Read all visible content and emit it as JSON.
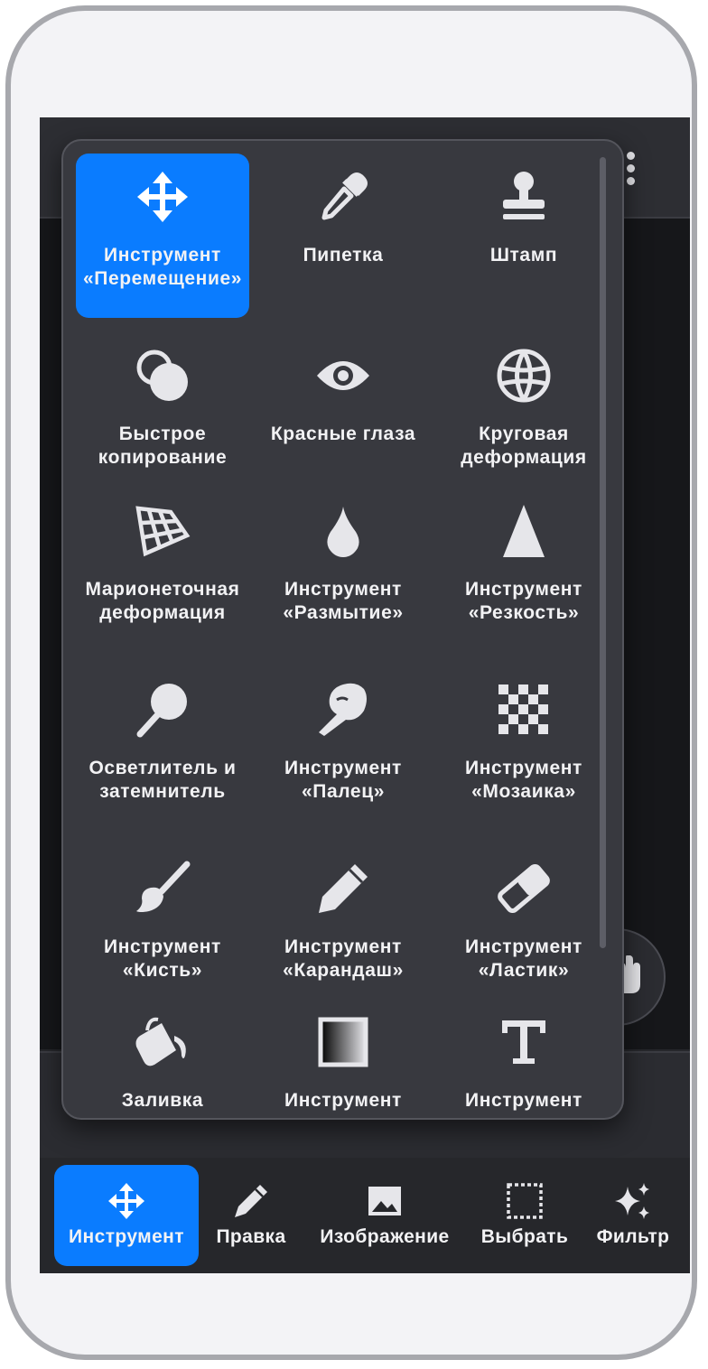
{
  "tools": [
    {
      "label": "Инструмент «Перемещение»",
      "icon": "move-arrows-icon",
      "selected": true
    },
    {
      "label": "Пипетка",
      "icon": "eyedropper-icon"
    },
    {
      "label": "Штамп",
      "icon": "stamp-icon"
    },
    {
      "label": "Быстрое копирование",
      "icon": "quick-copy-circles-icon"
    },
    {
      "label": "Красные глаза",
      "icon": "eye-icon"
    },
    {
      "label": "Круговая деформация",
      "icon": "globe-icon"
    },
    {
      "label": "Марионеточная деформация",
      "icon": "warp-grid-icon"
    },
    {
      "label": "Инструмент «Размытие»",
      "icon": "drop-icon"
    },
    {
      "label": "Инструмент «Резкость»",
      "icon": "triangle-icon"
    },
    {
      "label": "Осветлитель и затемнитель",
      "icon": "dodge-burn-icon"
    },
    {
      "label": "Инструмент «Палец»",
      "icon": "smudge-finger-icon"
    },
    {
      "label": "Инструмент «Мозаика»",
      "icon": "mosaic-checker-icon"
    },
    {
      "label": "Инструмент «Кисть»",
      "icon": "brush-icon"
    },
    {
      "label": "Инструмент «Карандаш»",
      "icon": "pencil-icon"
    },
    {
      "label": "Инструмент «Ластик»",
      "icon": "eraser-icon"
    },
    {
      "label": "Заливка",
      "icon": "paint-bucket-icon"
    },
    {
      "label": "Инструмент",
      "icon": "gradient-icon"
    },
    {
      "label": "Инструмент",
      "icon": "text-t-icon"
    }
  ],
  "bottom_nav": [
    {
      "label": "Инструмент",
      "icon": "move-arrows-icon",
      "active": true
    },
    {
      "label": "Правка",
      "icon": "pencil-icon"
    },
    {
      "label": "Изображение",
      "icon": "image-icon"
    },
    {
      "label": "Выбрать",
      "icon": "dashed-selection-icon"
    },
    {
      "label": "Фильтр",
      "icon": "sparkles-icon"
    }
  ],
  "colors": {
    "accent": "#0a7cff",
    "popover_bg": "#38393f",
    "screen_bg": "#26272b",
    "icon": "#e6e6ea"
  }
}
